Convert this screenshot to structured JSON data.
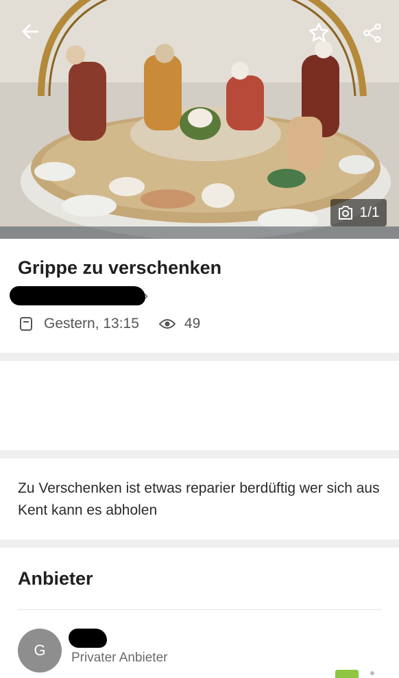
{
  "hero": {
    "image_alt": "",
    "counter": "1/1",
    "icons": {
      "back": "arrow-left-icon",
      "favorite": "star-outline-icon",
      "share": "share-icon",
      "camera": "camera-icon"
    }
  },
  "listing": {
    "title": "Grippe zu verschenken",
    "location": "",
    "date": "Gestern, 13:15",
    "views": "49"
  },
  "description": {
    "text": "Zu Verschenken ist etwas reparier berdüftig wer sich aus Kent kann es abholen"
  },
  "seller": {
    "heading": "Anbieter",
    "avatar_initial": "G",
    "name": "",
    "type": "Privater Anbieter"
  },
  "colors": {
    "gray_separator": "#efefef",
    "avatar": "#8e8e8e",
    "badge_green": "#8dc640",
    "text_dark": "#1f1f1f",
    "text_muted": "#555555"
  }
}
